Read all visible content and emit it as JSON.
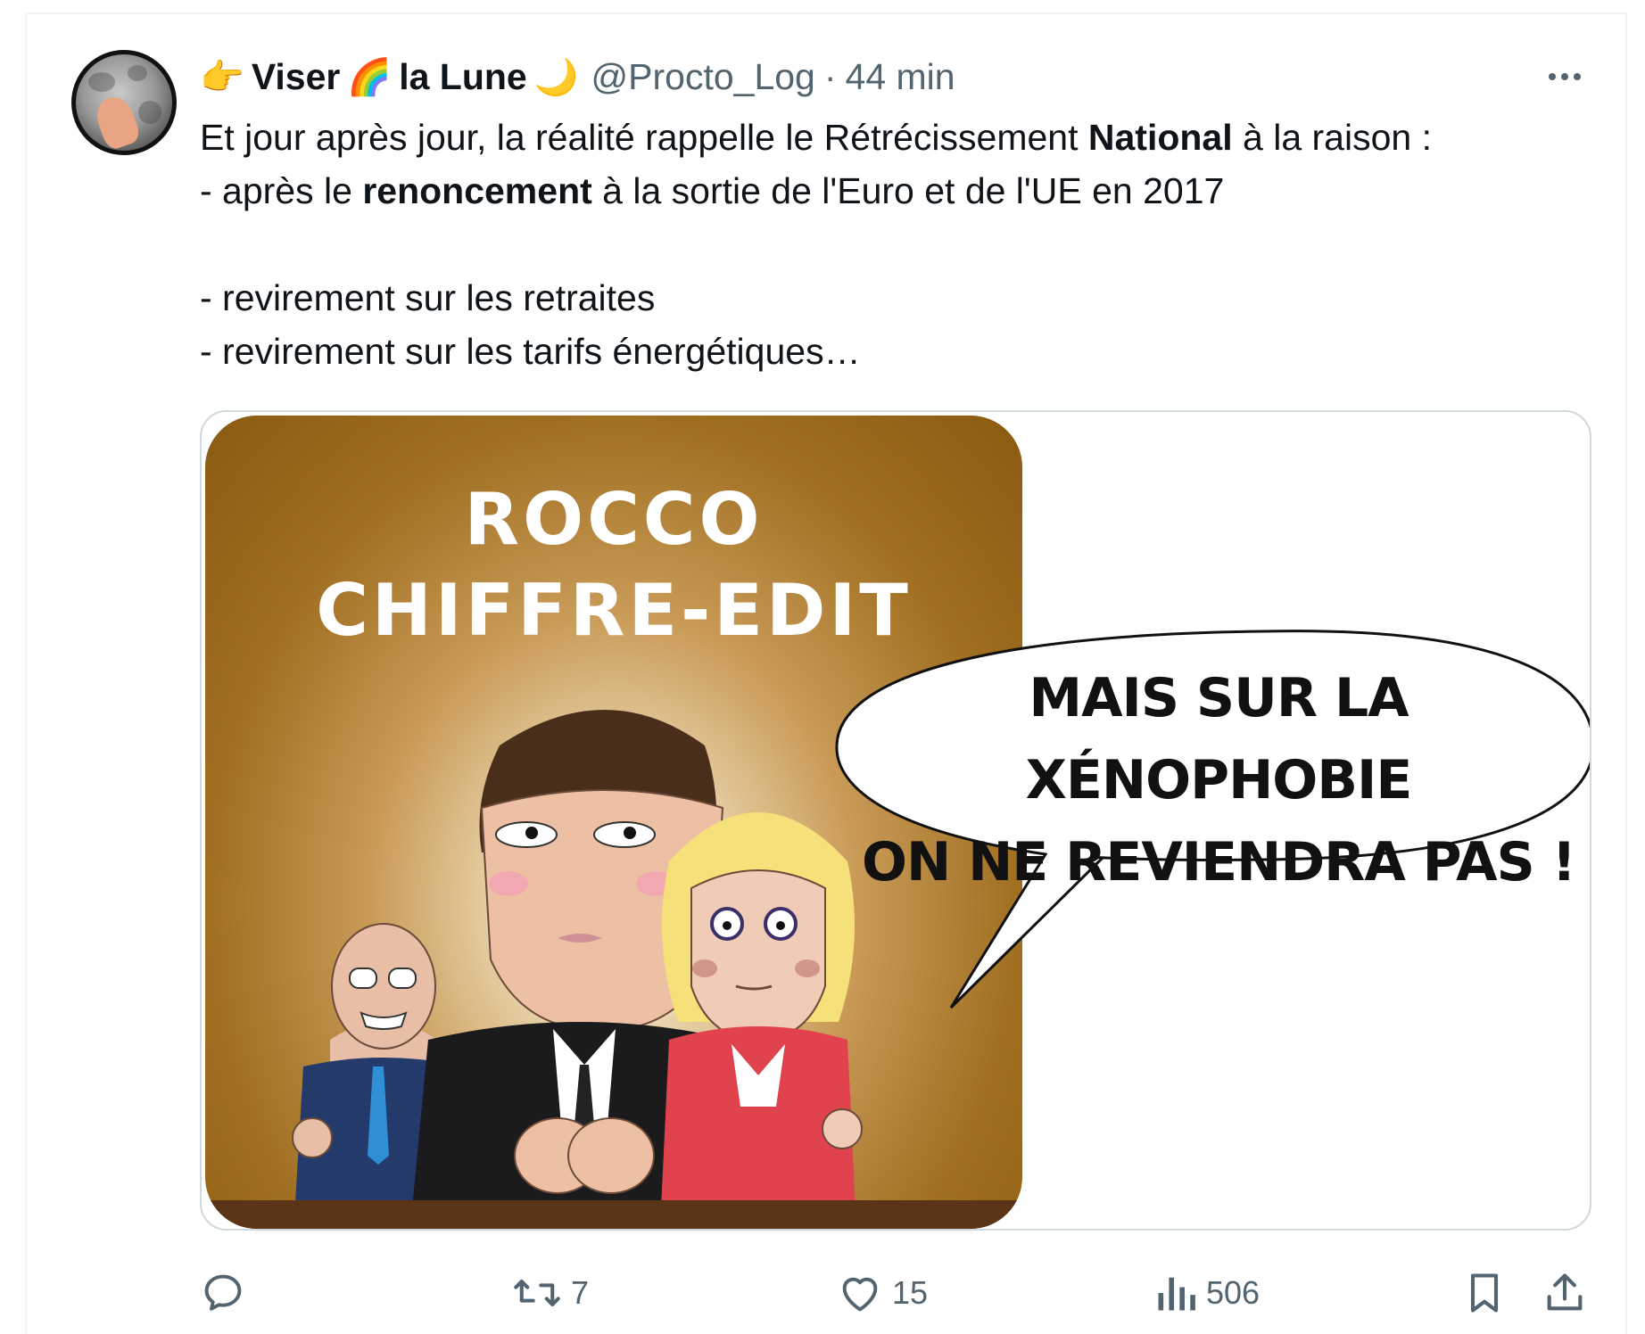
{
  "author": {
    "name_part1": "Viser",
    "name_part2": "la Lune",
    "emoji_point": "👉",
    "emoji_rainbow": "🌈",
    "emoji_moon": "🌙",
    "handle": "@Procto_Log",
    "separator": "·",
    "time": "44 min"
  },
  "tweet": {
    "line1_a": "Et jour après jour, la réalité rappelle le Rétrécissement ",
    "line1_b": "National",
    "line1_c": " à la raison :",
    "line2_a": "- après le ",
    "line2_b": "renoncement",
    "line2_c": " à la sortie de l'Euro et de l'UE en 2017",
    "line3": "- revirement sur les retraites",
    "line4": "- revirement sur les tarifs énergétiques…"
  },
  "media": {
    "title_line1": "ROCCO",
    "title_line2": "CHIFFRE-EDIT",
    "bubble_line1": "MAIS SUR LA XÉNOPHOBIE",
    "bubble_line2": "ON NE REVIENDRA PAS !"
  },
  "actions": {
    "reply_count": "",
    "retweet_count": "7",
    "like_count": "15",
    "views_count": "506"
  },
  "colors": {
    "text": "#0f1419",
    "secondary": "#536471",
    "border": "#cfd9de"
  }
}
